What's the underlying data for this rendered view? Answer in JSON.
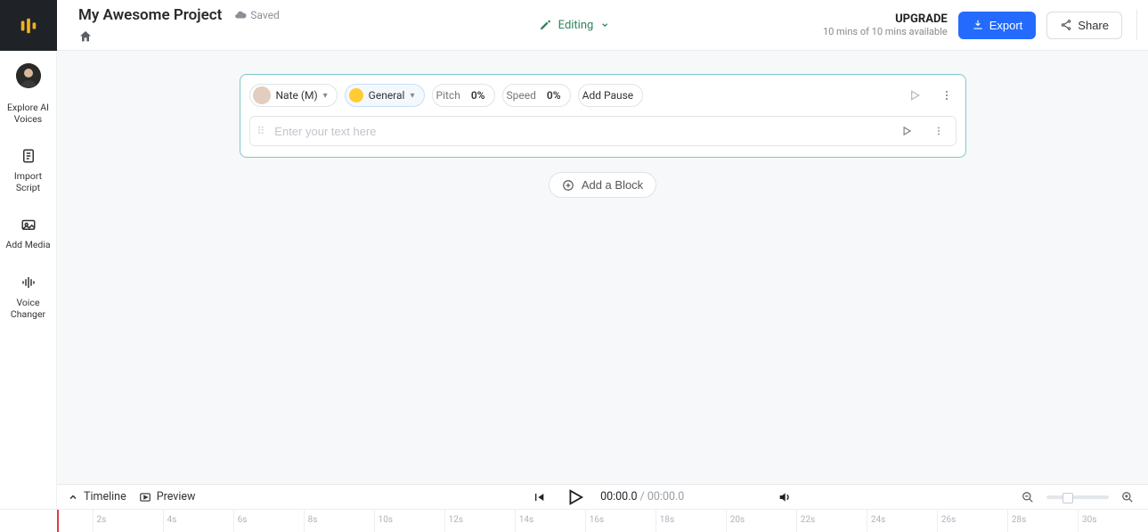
{
  "header": {
    "project_title": "My Awesome Project",
    "saved_label": "Saved",
    "mode_label": "Editing",
    "upgrade_title": "UPGRADE",
    "upgrade_sub": "10 mins of 10 mins available",
    "export_label": "Export",
    "share_label": "Share"
  },
  "sidebar": {
    "items": [
      {
        "label": "Explore AI Voices"
      },
      {
        "label": "Import Script"
      },
      {
        "label": "Add Media"
      },
      {
        "label": "Voice Changer"
      }
    ]
  },
  "block": {
    "voice_name": "Nate (M)",
    "style_label": "General",
    "pitch_label": "Pitch",
    "pitch_value": "0%",
    "speed_label": "Speed",
    "speed_value": "0%",
    "add_pause_label": "Add Pause",
    "text_placeholder": "Enter your text here",
    "add_block_label": "Add a Block"
  },
  "footer": {
    "timeline_label": "Timeline",
    "preview_label": "Preview",
    "time_current": "00:00.0",
    "time_separator": " / ",
    "time_total": "00:00.0"
  },
  "ruler": {
    "ticks": [
      "2s",
      "4s",
      "6s",
      "8s",
      "10s",
      "12s",
      "14s",
      "16s",
      "18s",
      "20s",
      "22s",
      "24s",
      "26s",
      "28s",
      "30s"
    ]
  },
  "colors": {
    "accent": "#246bfd",
    "teal_border": "#7fc7c7",
    "mode_green": "#2f855a"
  }
}
